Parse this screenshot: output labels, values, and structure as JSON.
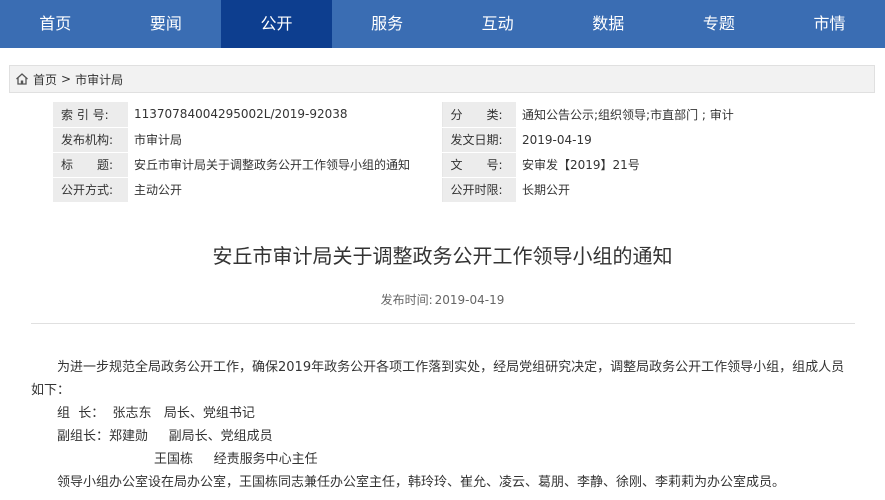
{
  "nav": {
    "items": [
      {
        "label": "首页"
      },
      {
        "label": "要闻"
      },
      {
        "label": "公开"
      },
      {
        "label": "服务"
      },
      {
        "label": "互动"
      },
      {
        "label": "数据"
      },
      {
        "label": "专题"
      },
      {
        "label": "市情"
      }
    ],
    "active_index": 2,
    "color": "#3a6db3",
    "active_color": "#0d3e8f"
  },
  "breadcrumb": {
    "home_icon": "home-icon",
    "home": "首页",
    "separator": ">",
    "current": "市审计局"
  },
  "info": {
    "index_label": "索 引 号:",
    "index_value": "11370784004295002L/2019-92038",
    "category_label": "分　　类:",
    "category_value": "通知公告公示;组织领导;市直部门 ; 审计",
    "publisher_label": "发布机构:",
    "publisher_value": "市审计局",
    "issue_date_label": "发文日期:",
    "issue_date_value": "2019-04-19",
    "title_label": "标　　题:",
    "title_value": "安丘市审计局关于调整政务公开工作领导小组的通知",
    "doc_no_label": "文　　号:",
    "doc_no_value": "安审发【2019】21号",
    "disclosure_label": "公开方式:",
    "disclosure_value": "主动公开",
    "period_label": "公开时限:",
    "period_value": "长期公开"
  },
  "article": {
    "title": "安丘市审计局关于调整政务公开工作领导小组的通知",
    "date_label": "发布时间:",
    "date_value": "2019-04-19",
    "paragraph1": "为进一步规范全局政务公开工作，确保2019年政务公开各项工作落到实处，经局党组研究决定，调整局政务公开工作领导小组，组成人员如下：",
    "line_leader": "组  长：  张志东   局长、党组书记",
    "line_deputy": "副组长：郑建勋     副局长、党组成员",
    "line_member": "王国栋     经责服务中心主任",
    "paragraph2": "领导小组办公室设在局办公室，王国栋同志兼任办公室主任，韩玲玲、崔允、凌云、葛朋、李静、徐刚、李莉莉为办公室成员。"
  }
}
